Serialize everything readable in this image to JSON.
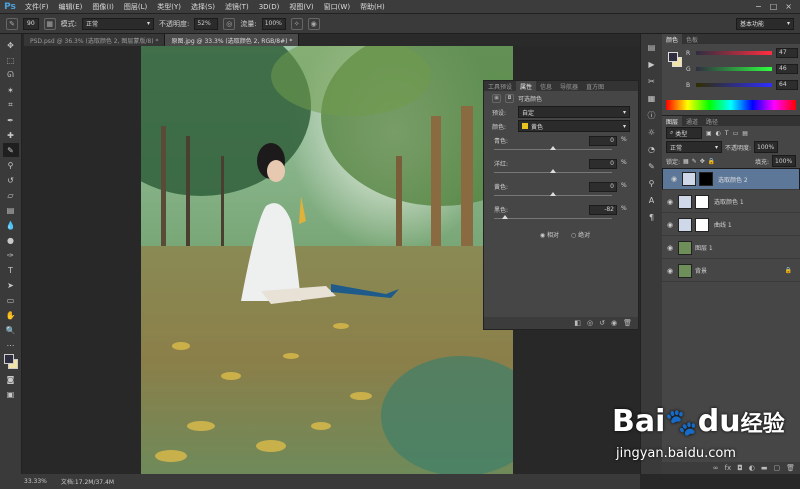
{
  "app": {
    "logo": "Ps"
  },
  "menu": [
    "文件(F)",
    "编辑(E)",
    "图像(I)",
    "图层(L)",
    "类型(Y)",
    "选择(S)",
    "滤镜(T)",
    "3D(D)",
    "视图(V)",
    "窗口(W)",
    "帮助(H)"
  ],
  "window_controls": [
    "−",
    "□",
    "×"
  ],
  "options": {
    "brush_size": "90",
    "mode_label": "模式:",
    "mode_value": "正常",
    "opacity_label": "不透明度:",
    "opacity_value": "52%",
    "flow_label": "流量:",
    "flow_value": "100%",
    "workspace": "基本功能"
  },
  "doc_tabs": [
    "PSD.psd @ 36.3% (选取颜色 2, 图层蒙版/8) *",
    "原图.jpg @ 33.3% (选取颜色 2, RGB/8#) *"
  ],
  "status": {
    "zoom": "33.33%",
    "doc_info": "文档:17.2M/37.4M"
  },
  "properties": {
    "tabs": [
      "工具预设",
      "属性",
      "信息",
      "导航器",
      "直方图"
    ],
    "title": "可选颜色",
    "preset_label": "预设:",
    "preset_value": "自定",
    "colors_label": "颜色:",
    "colors_value": "黄色",
    "sliders": [
      {
        "label": "青色:",
        "value": "0",
        "level": 0
      },
      {
        "label": "洋红:",
        "value": "0",
        "level": 0
      },
      {
        "label": "黄色:",
        "value": "0",
        "level": 0
      },
      {
        "label": "黑色:",
        "value": "-82",
        "level": -82
      }
    ],
    "unit": "%",
    "method_relative": "相对",
    "method_absolute": "绝对"
  },
  "color_panel": {
    "tabs": [
      "颜色",
      "色板"
    ],
    "channels": [
      {
        "label": "R",
        "value": "47"
      },
      {
        "label": "G",
        "value": "46"
      },
      {
        "label": "B",
        "value": "64"
      }
    ]
  },
  "layers_panel": {
    "tabs": [
      "图层",
      "通道",
      "路径"
    ],
    "filter": "类型",
    "blend_mode": "正常",
    "opacity_label": "不透明度:",
    "opacity_value": "100%",
    "lock_label": "锁定:",
    "fill_label": "填充:",
    "fill_value": "100%",
    "layers": [
      {
        "name": "选取颜色 2",
        "selected": true
      },
      {
        "name": "选取颜色 1",
        "selected": false
      },
      {
        "name": "曲线 1",
        "selected": false
      },
      {
        "name": "图层 1",
        "selected": false
      },
      {
        "name": "背景",
        "selected": false
      }
    ]
  },
  "watermark": {
    "brand": "Bai",
    "brand2": "du",
    "suffix": "经验",
    "url": "jingyan.baidu.com"
  }
}
